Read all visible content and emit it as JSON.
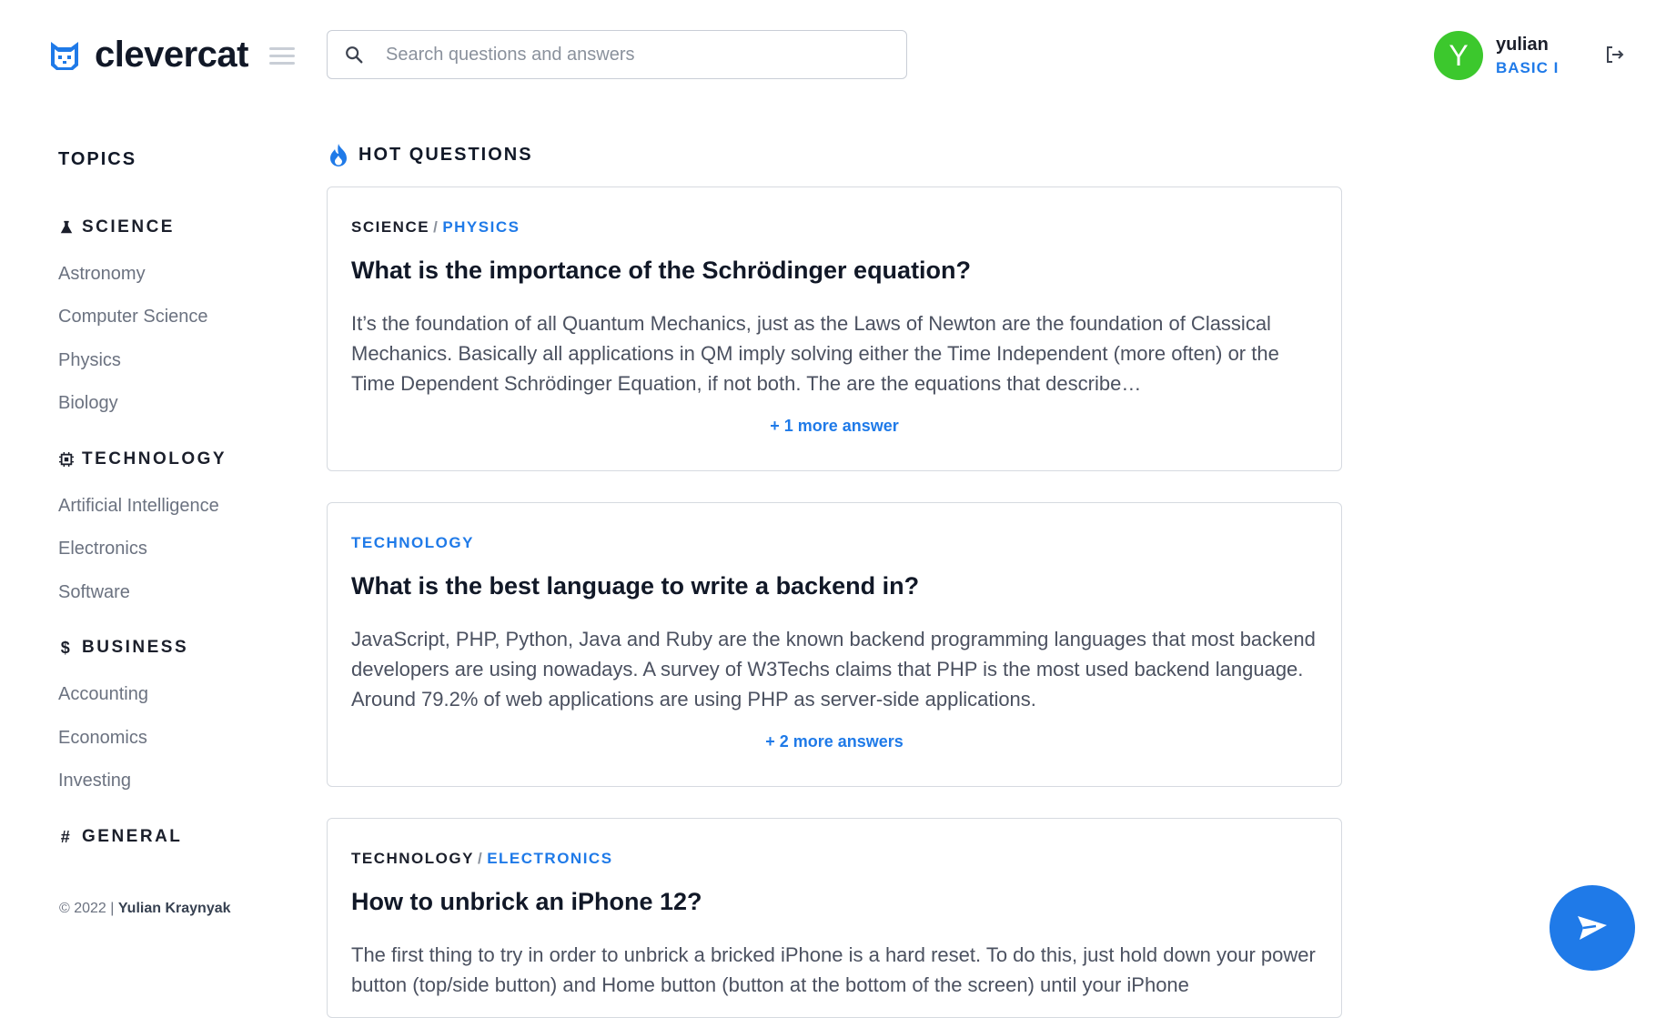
{
  "header": {
    "brand": "clevercat",
    "search_placeholder": "Search questions and answers",
    "user": {
      "initial": "Y",
      "name": "yulian",
      "plan": "BASIC I"
    }
  },
  "sidebar": {
    "title": "TOPICS",
    "categories": [
      {
        "label": "SCIENCE",
        "icon": "flask-icon",
        "items": [
          "Astronomy",
          "Computer Science",
          "Physics",
          "Biology"
        ]
      },
      {
        "label": "TECHNOLOGY",
        "icon": "chip-icon",
        "items": [
          "Artificial Intelligence",
          "Electronics",
          "Software"
        ]
      },
      {
        "label": "BUSINESS",
        "icon": "dollar-icon",
        "items": [
          "Accounting",
          "Economics",
          "Investing"
        ]
      },
      {
        "label": "GENERAL",
        "icon": "hash-icon",
        "items": []
      }
    ],
    "footer_year": "© 2022 |",
    "footer_author": "Yulian Kraynyak"
  },
  "main": {
    "section_title": "HOT QUESTIONS",
    "questions": [
      {
        "category": "SCIENCE",
        "subcategory": "PHYSICS",
        "title": "What is the importance of the Schrödinger equation?",
        "answer": "It’s the foundation of all Quantum Mechanics, just as the Laws of Newton are the foundation of Classical Mechanics. Basically all applications in QM imply solving either the Time Independent (more often) or the Time Dependent Schrödinger Equation, if not both. The are the equations that describe…",
        "more": "+ 1 more answer"
      },
      {
        "category": "TECHNOLOGY",
        "subcategory": "",
        "title": "What is the best language to write a backend in?",
        "answer": "JavaScript, PHP, Python, Java and Ruby are the known backend programming languages that most backend developers are using nowadays. A survey of W3Techs claims that PHP is the most used backend language. Around 79.2% of web applications are using PHP as server-side applications.",
        "more": "+ 2 more answers"
      },
      {
        "category": "TECHNOLOGY",
        "subcategory": "ELECTRONICS",
        "title": "How to unbrick an iPhone 12?",
        "answer": "The first thing to try in order to unbrick a bricked iPhone is a hard reset. To do this, just hold down your power button (top/side button) and Home button (button at the bottom of the screen) until your iPhone",
        "more": ""
      }
    ]
  },
  "colors": {
    "accent": "#1f7ae8",
    "avatar": "#3cc82d",
    "text": "#1b1f2b",
    "muted": "#6b7280"
  }
}
